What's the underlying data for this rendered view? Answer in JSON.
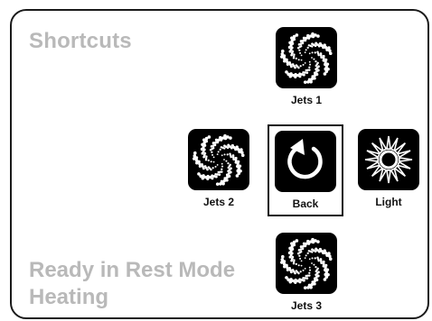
{
  "panel": {
    "title": "Shortcuts",
    "status_line1": "Ready in Rest Mode",
    "status_line2": "Heating"
  },
  "shortcuts": [
    {
      "label": "Jets 1",
      "icon": "jets-icon"
    },
    {
      "label": "Jets 2",
      "icon": "jets-icon"
    },
    {
      "label": "Back",
      "icon": "back-arrow-icon",
      "selected": true
    },
    {
      "label": "Light",
      "icon": "light-icon"
    },
    {
      "label": "Jets 3",
      "icon": "jets-icon"
    }
  ],
  "colors": {
    "title_text": "#b9b9b9",
    "icon_bg": "#000000",
    "border": "#1a1a1a"
  }
}
